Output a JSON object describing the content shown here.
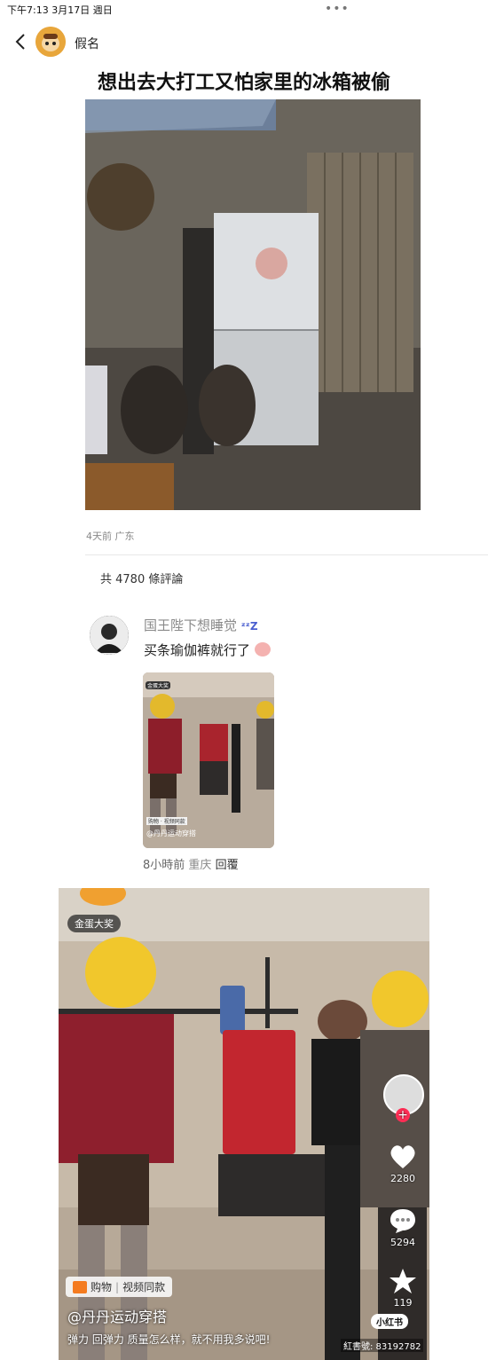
{
  "status_bar": {
    "time_date": "下午7:13  3月17日 週日",
    "menu_dots": "•••"
  },
  "header": {
    "author": "假名"
  },
  "post": {
    "title": "想出去大打工又怕家里的冰箱被偷",
    "meta": "4天前 广东",
    "comment_count": "共 4780 條評論"
  },
  "comment": {
    "username": "国王陛下想睡觉",
    "text": "买条瑜伽裤就行了",
    "thumb_badge": "金蛋大奖",
    "thumb_author": "@丹丹运动穿搭",
    "thumb_shop": "购物 · 视频同款",
    "meta_time": "8小時前",
    "meta_location": "重庆",
    "reply": "回覆"
  },
  "video": {
    "badge": "金蛋大奖",
    "shop_label": "购物",
    "shop_sub": "视频同款",
    "author": "@丹丹运动穿搭",
    "description": "弹力 回弹力 质量怎么样，就不用我多说吧!",
    "likes": "2280",
    "comments": "5294",
    "favorites": "119",
    "logo": "小红书",
    "watermark": "紅書號: 83192782"
  }
}
